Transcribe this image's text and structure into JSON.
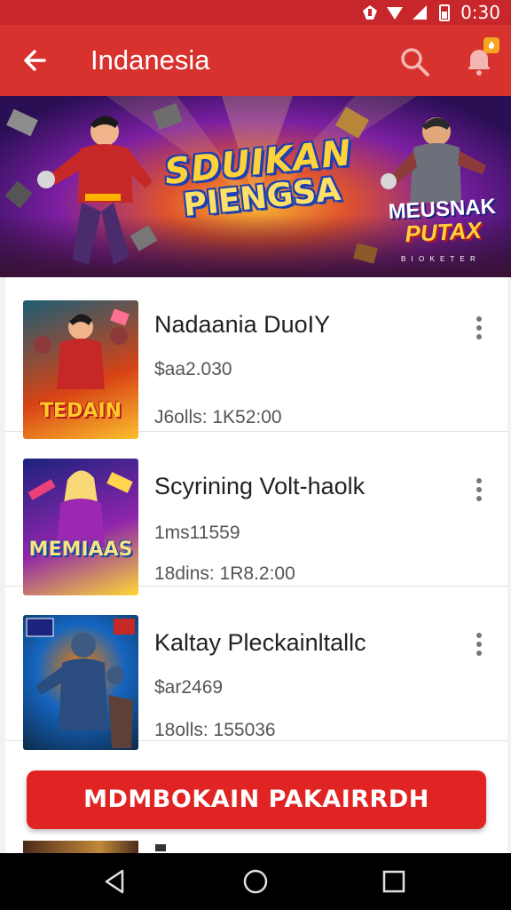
{
  "status_bar": {
    "time": "0:30",
    "icons": [
      "signal-icon",
      "wifi-icon",
      "battery-icon"
    ]
  },
  "app_bar": {
    "title": "Indanesia",
    "back_icon": "arrow-left-icon",
    "search_icon": "search-icon",
    "notification_icon": "bell-icon"
  },
  "banner": {
    "title_line1": "SDUIKAN",
    "title_line2": "PIENGSA",
    "subtitle_line1": "MEUSNAK",
    "subtitle_line2": "PUTAX",
    "small_text": "B I O K E T E R",
    "pager": {
      "count": 3,
      "active": 0
    }
  },
  "games": [
    {
      "title": "Nadaania DuoIY",
      "price": "$aa2.030",
      "meta": "J6olls: 1K52:00",
      "thumb_label": "TEDAIN",
      "thumb_colors": [
        "#1b5e74",
        "#d84315",
        "#fbc02d"
      ]
    },
    {
      "title": "Scyrining Volt-haolk",
      "price": "1ms11559",
      "meta": "18dins: 1R8.2:00",
      "thumb_label": "MEMIAAS",
      "thumb_colors": [
        "#1a237e",
        "#8e24aa",
        "#fdd835"
      ]
    },
    {
      "title": "Kaltay Pleckainltallc",
      "price": "$ar2469",
      "meta": "18olls: 155036",
      "thumb_label": "",
      "thumb_colors": [
        "#0d2a4a",
        "#1565c0",
        "#f57c00"
      ]
    }
  ],
  "cta": {
    "label": "MDMBOKAIN PAKAIRRDH"
  },
  "nav_bar": {
    "icons": [
      "back-triangle-icon",
      "home-circle-icon",
      "recents-square-icon"
    ]
  },
  "colors": {
    "primary": "#d8322f",
    "status": "#c7262b",
    "cta": "#e02323",
    "badge": "#f6a623"
  }
}
